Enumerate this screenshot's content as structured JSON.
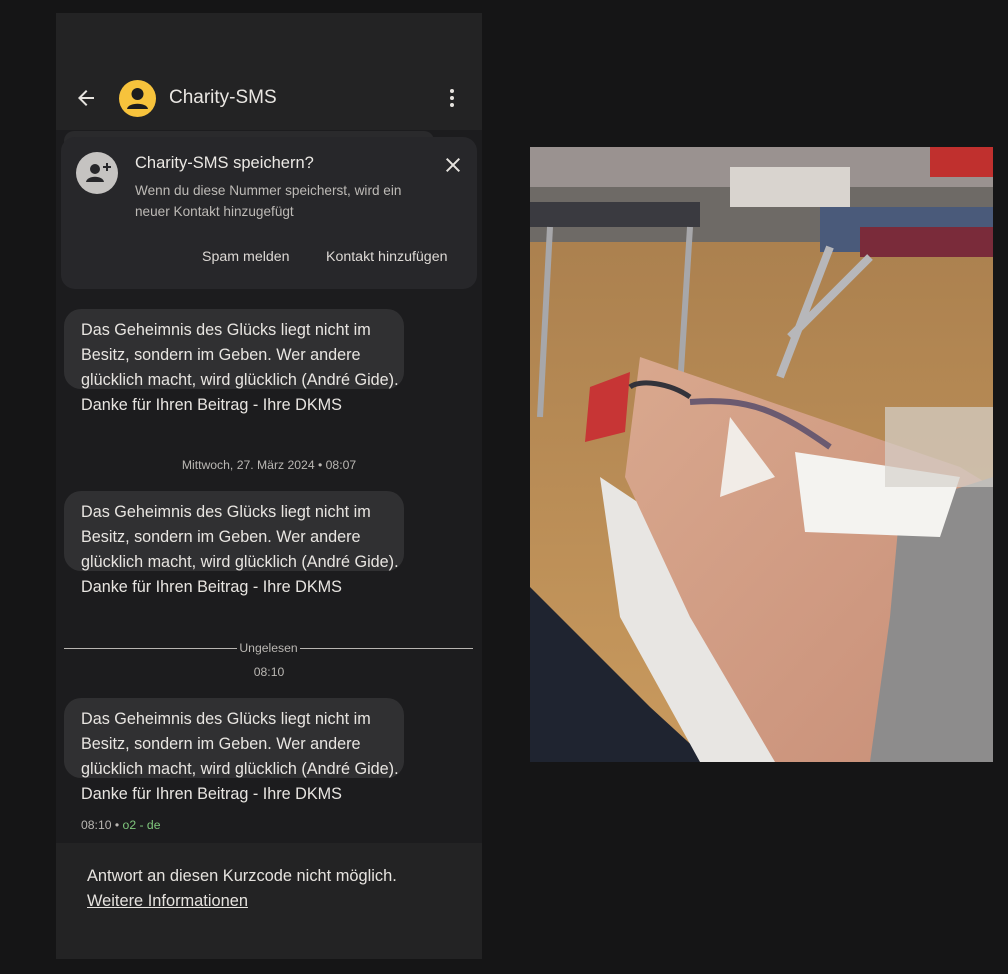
{
  "header": {
    "contact_name": "Charity-SMS"
  },
  "banner": {
    "title": "Charity-SMS speichern?",
    "text": "Wenn du diese Nummer speicherst, wird ein neuer Kontakt hinzugefügt",
    "spam_label": "Spam melden",
    "add_contact_label": "Kontakt hinzufügen"
  },
  "messages": [
    {
      "lines": [
        "Das Geheimnis des Glücks liegt nicht im",
        "Besitz, sondern im Geben. Wer andere",
        "glücklich macht, wird glücklich (André Gide).",
        "Danke für Ihren Beitrag - Ihre DKMS"
      ]
    },
    {
      "lines": [
        "Das Geheimnis des Glücks liegt nicht im",
        "Besitz, sondern im Geben. Wer andere",
        "glücklich macht, wird glücklich (André Gide).",
        "Danke für Ihren Beitrag - Ihre DKMS"
      ]
    },
    {
      "lines": [
        "Das Geheimnis des Glücks liegt nicht im",
        "Besitz, sondern im Geben. Wer andere",
        "glücklich macht, wird glücklich (André Gide).",
        "Danke für Ihren Beitrag - Ihre DKMS"
      ]
    }
  ],
  "timestamps": {
    "date_separator": "Mittwoch, 27. März 2024 • 08:07",
    "unread_label": "Ungelesen",
    "unread_time": "08:10"
  },
  "last_message_meta": {
    "time": "08:10",
    "separator": " • ",
    "carrier": "o2 - de"
  },
  "footer": {
    "text": "Antwort an diesen Kurzcode nicht möglich.",
    "link": "Weitere Informationen"
  },
  "colors": {
    "avatar": "#f7c33c",
    "carrier_text": "#7fc77d",
    "bubble": "#303032",
    "background": "#1c1c1e"
  },
  "icons": [
    "arrow-back-icon",
    "person-icon",
    "more-vert-icon",
    "person-add-icon",
    "close-icon"
  ]
}
